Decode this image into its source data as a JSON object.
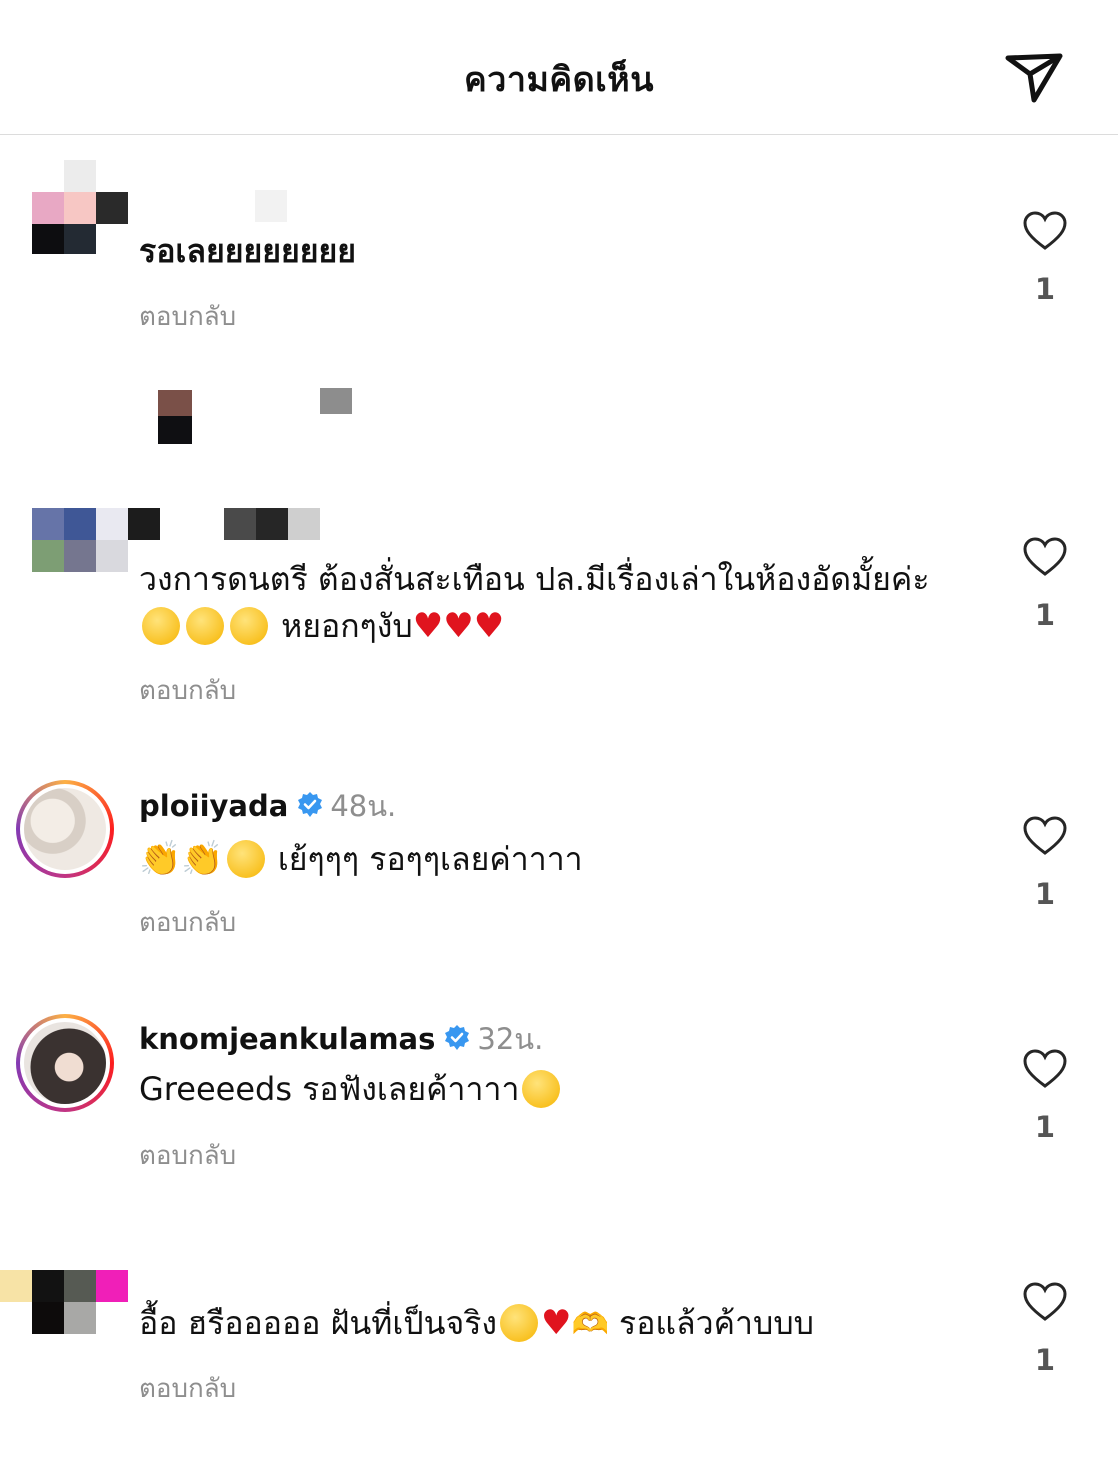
{
  "header": {
    "title": "ความคิดเห็น"
  },
  "comments": [
    {
      "text": "รอเลยยยยยยยย",
      "reply": "ตอบกลับ",
      "likes": "1"
    },
    {
      "text_before": "วงการดนตรี ต้องสั่นสะเทือน ปล.มีเรื่องเล่าในห้องอัดมั้ยค่ะ",
      "text_after": "หยอกๆงับ",
      "reply": "ตอบกลับ",
      "likes": "1"
    },
    {
      "username": "ploiiyada",
      "time": "48น.",
      "text": "เย้ๆๆๆ รอๆๆเลยค่าาาา",
      "reply": "ตอบกลับ",
      "likes": "1"
    },
    {
      "username": "knomjeankulamas",
      "time": "32น.",
      "text": "Greeeeds รอฟังเลยค้าาาา",
      "reply": "ตอบกลับ",
      "likes": "1"
    },
    {
      "text_before": "อื้อ ฮรือออออ ฝันที่เป็นจริง",
      "text_after": "รอแล้วค้าบบบ",
      "reply": "ตอบกลับ",
      "likes": "1"
    }
  ],
  "icons": {
    "send": "paper-plane-icon",
    "like": "heart-outline-icon",
    "verified": "verified-badge-icon"
  },
  "colors": {
    "verified": "#3897f0",
    "muted": "#8e8e8e",
    "heart": "#e0141e"
  }
}
